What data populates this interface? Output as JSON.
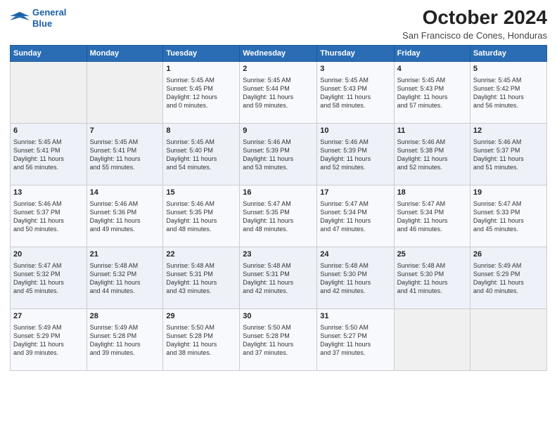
{
  "header": {
    "logo_line1": "General",
    "logo_line2": "Blue",
    "month": "October 2024",
    "location": "San Francisco de Cones, Honduras"
  },
  "days_of_week": [
    "Sunday",
    "Monday",
    "Tuesday",
    "Wednesday",
    "Thursday",
    "Friday",
    "Saturday"
  ],
  "weeks": [
    [
      {
        "day": "",
        "content": ""
      },
      {
        "day": "",
        "content": ""
      },
      {
        "day": "1",
        "content": "Sunrise: 5:45 AM\nSunset: 5:45 PM\nDaylight: 12 hours\nand 0 minutes."
      },
      {
        "day": "2",
        "content": "Sunrise: 5:45 AM\nSunset: 5:44 PM\nDaylight: 11 hours\nand 59 minutes."
      },
      {
        "day": "3",
        "content": "Sunrise: 5:45 AM\nSunset: 5:43 PM\nDaylight: 11 hours\nand 58 minutes."
      },
      {
        "day": "4",
        "content": "Sunrise: 5:45 AM\nSunset: 5:43 PM\nDaylight: 11 hours\nand 57 minutes."
      },
      {
        "day": "5",
        "content": "Sunrise: 5:45 AM\nSunset: 5:42 PM\nDaylight: 11 hours\nand 56 minutes."
      }
    ],
    [
      {
        "day": "6",
        "content": "Sunrise: 5:45 AM\nSunset: 5:41 PM\nDaylight: 11 hours\nand 56 minutes."
      },
      {
        "day": "7",
        "content": "Sunrise: 5:45 AM\nSunset: 5:41 PM\nDaylight: 11 hours\nand 55 minutes."
      },
      {
        "day": "8",
        "content": "Sunrise: 5:45 AM\nSunset: 5:40 PM\nDaylight: 11 hours\nand 54 minutes."
      },
      {
        "day": "9",
        "content": "Sunrise: 5:46 AM\nSunset: 5:39 PM\nDaylight: 11 hours\nand 53 minutes."
      },
      {
        "day": "10",
        "content": "Sunrise: 5:46 AM\nSunset: 5:39 PM\nDaylight: 11 hours\nand 52 minutes."
      },
      {
        "day": "11",
        "content": "Sunrise: 5:46 AM\nSunset: 5:38 PM\nDaylight: 11 hours\nand 52 minutes."
      },
      {
        "day": "12",
        "content": "Sunrise: 5:46 AM\nSunset: 5:37 PM\nDaylight: 11 hours\nand 51 minutes."
      }
    ],
    [
      {
        "day": "13",
        "content": "Sunrise: 5:46 AM\nSunset: 5:37 PM\nDaylight: 11 hours\nand 50 minutes."
      },
      {
        "day": "14",
        "content": "Sunrise: 5:46 AM\nSunset: 5:36 PM\nDaylight: 11 hours\nand 49 minutes."
      },
      {
        "day": "15",
        "content": "Sunrise: 5:46 AM\nSunset: 5:35 PM\nDaylight: 11 hours\nand 48 minutes."
      },
      {
        "day": "16",
        "content": "Sunrise: 5:47 AM\nSunset: 5:35 PM\nDaylight: 11 hours\nand 48 minutes."
      },
      {
        "day": "17",
        "content": "Sunrise: 5:47 AM\nSunset: 5:34 PM\nDaylight: 11 hours\nand 47 minutes."
      },
      {
        "day": "18",
        "content": "Sunrise: 5:47 AM\nSunset: 5:34 PM\nDaylight: 11 hours\nand 46 minutes."
      },
      {
        "day": "19",
        "content": "Sunrise: 5:47 AM\nSunset: 5:33 PM\nDaylight: 11 hours\nand 45 minutes."
      }
    ],
    [
      {
        "day": "20",
        "content": "Sunrise: 5:47 AM\nSunset: 5:32 PM\nDaylight: 11 hours\nand 45 minutes."
      },
      {
        "day": "21",
        "content": "Sunrise: 5:48 AM\nSunset: 5:32 PM\nDaylight: 11 hours\nand 44 minutes."
      },
      {
        "day": "22",
        "content": "Sunrise: 5:48 AM\nSunset: 5:31 PM\nDaylight: 11 hours\nand 43 minutes."
      },
      {
        "day": "23",
        "content": "Sunrise: 5:48 AM\nSunset: 5:31 PM\nDaylight: 11 hours\nand 42 minutes."
      },
      {
        "day": "24",
        "content": "Sunrise: 5:48 AM\nSunset: 5:30 PM\nDaylight: 11 hours\nand 42 minutes."
      },
      {
        "day": "25",
        "content": "Sunrise: 5:48 AM\nSunset: 5:30 PM\nDaylight: 11 hours\nand 41 minutes."
      },
      {
        "day": "26",
        "content": "Sunrise: 5:49 AM\nSunset: 5:29 PM\nDaylight: 11 hours\nand 40 minutes."
      }
    ],
    [
      {
        "day": "27",
        "content": "Sunrise: 5:49 AM\nSunset: 5:29 PM\nDaylight: 11 hours\nand 39 minutes."
      },
      {
        "day": "28",
        "content": "Sunrise: 5:49 AM\nSunset: 5:28 PM\nDaylight: 11 hours\nand 39 minutes."
      },
      {
        "day": "29",
        "content": "Sunrise: 5:50 AM\nSunset: 5:28 PM\nDaylight: 11 hours\nand 38 minutes."
      },
      {
        "day": "30",
        "content": "Sunrise: 5:50 AM\nSunset: 5:28 PM\nDaylight: 11 hours\nand 37 minutes."
      },
      {
        "day": "31",
        "content": "Sunrise: 5:50 AM\nSunset: 5:27 PM\nDaylight: 11 hours\nand 37 minutes."
      },
      {
        "day": "",
        "content": ""
      },
      {
        "day": "",
        "content": ""
      }
    ]
  ]
}
